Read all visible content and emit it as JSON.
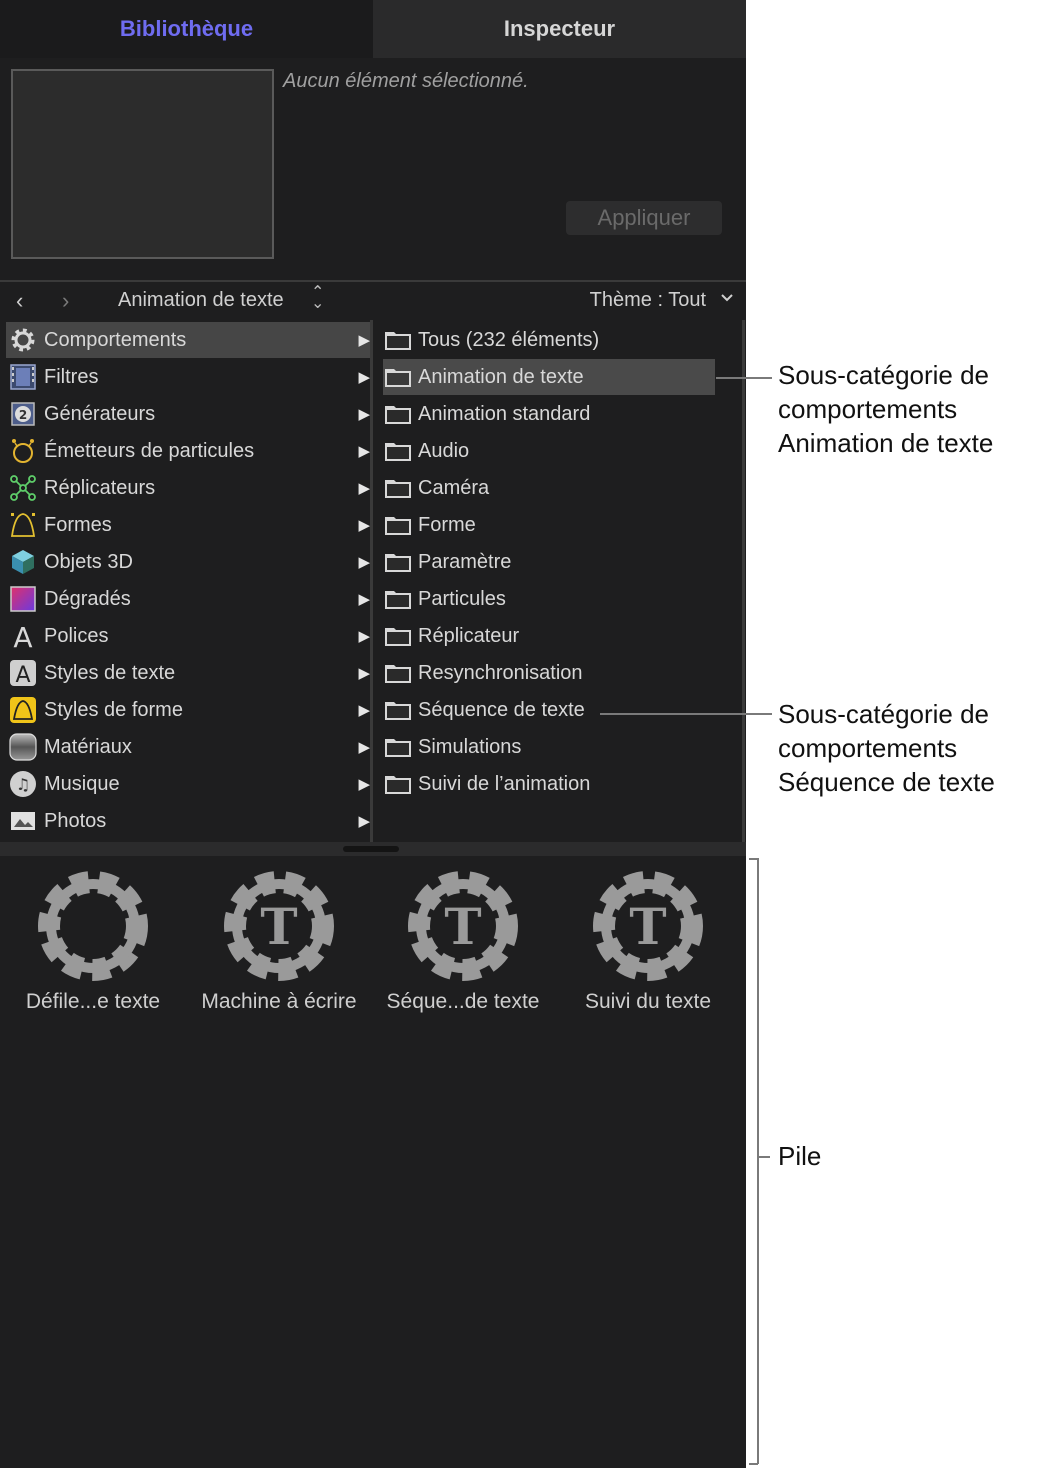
{
  "tabs": [
    {
      "label": "Bibliothèque",
      "active": true
    },
    {
      "label": "Inspecteur",
      "active": false
    }
  ],
  "preview": {
    "no_selection_text": "Aucun élément sélectionné.",
    "apply_label": "Appliquer"
  },
  "navbar": {
    "back": "‹",
    "forward": "›",
    "title": "Animation de texte",
    "theme": "Thème : Tout"
  },
  "categories": [
    {
      "label": "Comportements",
      "icon": "gear-icon",
      "selected": true
    },
    {
      "label": "Filtres",
      "icon": "film-icon"
    },
    {
      "label": "Générateurs",
      "icon": "generator-icon"
    },
    {
      "label": "Émetteurs de particules",
      "icon": "emitter-icon"
    },
    {
      "label": "Réplicateurs",
      "icon": "replicator-icon"
    },
    {
      "label": "Formes",
      "icon": "shape-icon"
    },
    {
      "label": "Objets 3D",
      "icon": "cube-icon"
    },
    {
      "label": "Dégradés",
      "icon": "gradient-icon"
    },
    {
      "label": "Polices",
      "icon": "font-icon"
    },
    {
      "label": "Styles de texte",
      "icon": "text-style-icon"
    },
    {
      "label": "Styles de forme",
      "icon": "shape-style-icon"
    },
    {
      "label": "Matériaux",
      "icon": "material-icon"
    },
    {
      "label": "Musique",
      "icon": "music-icon"
    },
    {
      "label": "Photos",
      "icon": "photo-icon"
    }
  ],
  "subcategories": [
    {
      "label": "Tous (232 éléments)"
    },
    {
      "label": "Animation de texte",
      "selected": true
    },
    {
      "label": "Animation standard"
    },
    {
      "label": "Audio"
    },
    {
      "label": "Caméra"
    },
    {
      "label": "Forme"
    },
    {
      "label": "Paramètre"
    },
    {
      "label": "Particules"
    },
    {
      "label": "Réplicateur"
    },
    {
      "label": "Resynchronisation"
    },
    {
      "label": "Séquence de texte"
    },
    {
      "label": "Simulations"
    },
    {
      "label": "Suivi de l’animation"
    }
  ],
  "stack": [
    {
      "label": "Défile...e texte",
      "badge": ""
    },
    {
      "label": "Machine à écrire",
      "badge": "T"
    },
    {
      "label": "Séque...de texte",
      "badge": "T"
    },
    {
      "label": "Suivi du texte",
      "badge": "T"
    }
  ],
  "annotations": {
    "callout1": [
      "Sous-catégorie de",
      "comportements",
      "Animation de texte"
    ],
    "callout2": [
      "Sous-catégorie de",
      "comportements",
      "Séquence de texte"
    ],
    "callout3": "Pile"
  },
  "colors": {
    "accent": "#6f6cf0",
    "panel_bg": "#1e1e1f",
    "selected_row": "#464646",
    "gear": "#9a9a9a"
  }
}
